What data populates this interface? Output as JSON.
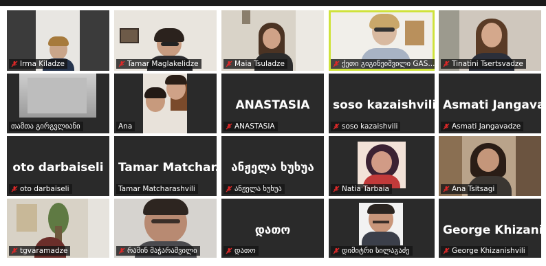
{
  "participants": [
    {
      "name": "Irma Kiladze",
      "muted": true
    },
    {
      "name": "Tamar Maglakelidze",
      "muted": true
    },
    {
      "name": "Maia Tsuladze",
      "muted": true
    },
    {
      "name": "ქეთი გიგინეიშვილი GAS...",
      "muted": true,
      "active_speaker": true
    },
    {
      "name": "Tinatini Tsertsvadze",
      "muted": true
    },
    {
      "name": "თამთა გირგვლიანი",
      "muted": false
    },
    {
      "name": "Ana",
      "muted": false
    },
    {
      "name": "ANASTASIA",
      "muted": true,
      "display": "ANASTASIA"
    },
    {
      "name": "soso kazaishvili",
      "muted": true,
      "display": "soso kazaishvili"
    },
    {
      "name": "Asmati Jangavadze",
      "muted": true,
      "display": "Asmati  Jangava..."
    },
    {
      "name": "oto darbaiseli",
      "muted": true,
      "display": "oto darbaiseli"
    },
    {
      "name": "Tamar Matcharashvili",
      "muted": false,
      "display": "Tamar  Matchar..."
    },
    {
      "name": "ანჟელა ხუხუა",
      "muted": true,
      "display": "ანჟელა ხუხუა"
    },
    {
      "name": "Natia Tarbaia",
      "muted": true
    },
    {
      "name": "Ana Tsitsagi",
      "muted": true
    },
    {
      "name": "tgvaramadze",
      "muted": true
    },
    {
      "name": "რამინ მაჭარაშვილი",
      "muted": true
    },
    {
      "name": "დათო",
      "muted": true,
      "display": "დათო"
    },
    {
      "name": "დიმიტრი სილაგაძე",
      "muted": true
    },
    {
      "name": "George  Khizanishvili",
      "muted": true,
      "display": "George  Khizani..."
    }
  ],
  "colors": {
    "tile_bg": "#2a2a2a",
    "active_border": "#cfe23c",
    "muted_icon": "#e02828",
    "label_text": "#ffffff"
  }
}
